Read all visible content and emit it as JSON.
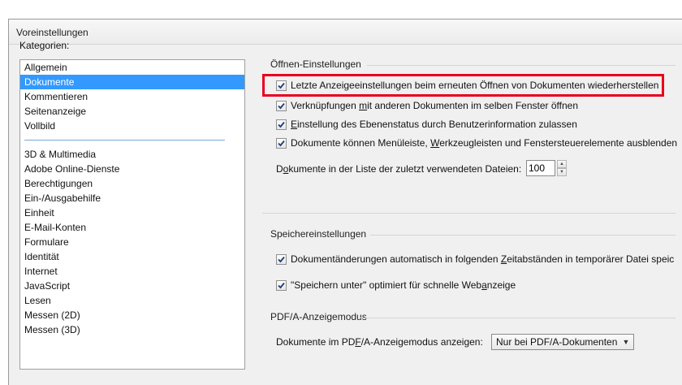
{
  "window": {
    "title": "Voreinstellungen"
  },
  "categories": {
    "label": "Kategorien:",
    "group1": [
      "Allgemein",
      "Dokumente",
      "Kommentieren",
      "Seitenanzeige",
      "Vollbild"
    ],
    "selected": "Dokumente",
    "group2": [
      "3D & Multimedia",
      "Adobe Online-Dienste",
      "Berechtigungen",
      "Ein-/Ausgabehilfe",
      "Einheit",
      "E-Mail-Konten",
      "Formulare",
      "Identität",
      "Internet",
      "JavaScript",
      "Lesen",
      "Messen (2D)",
      "Messen (3D)"
    ]
  },
  "open_settings": {
    "title": "Öffnen-Einstellungen",
    "cb1": {
      "label": "Letzte Anzeigeeinstellungen beim erneuten Öffnen von Dokumenten wiederherstellen",
      "checked": true
    },
    "cb2": {
      "pre": "Verknüpfungen ",
      "ul": "m",
      "post": "it anderen Dokumenten im selben Fenster öffnen",
      "checked": true
    },
    "cb3": {
      "ul": "E",
      "post": "instellung des Ebenenstatus durch Benutzerinformation zulassen",
      "checked": true
    },
    "cb4": {
      "pre": "Dokumente können Menüleiste, ",
      "ul": "W",
      "post": "erkzeugleisten und Fenstersteuerelemente ausblenden",
      "checked": true
    },
    "recent": {
      "pre": "D",
      "ul": "o",
      "post": "kumente in der Liste der zuletzt verwendeten Dateien:",
      "value": "100"
    }
  },
  "save_settings": {
    "title": "Speichereinstellungen",
    "cb1": {
      "pre": "Dokumentänderungen automatisch in folgenden ",
      "ul": "Z",
      "post": "eitabständen in temporärer Datei speic",
      "checked": true
    },
    "cb2": {
      "pre": "\"Speichern unter\" optimiert für schnelle Web",
      "ul": "a",
      "post": "nzeige",
      "checked": true
    }
  },
  "pdfa": {
    "title": "PDF/A-Anzeigemodus",
    "label_pre": "Dokumente im PD",
    "label_ul": "F",
    "label_post": "/A-Anzeigemodus anzeigen:",
    "select_value": "Nur bei PDF/A-Dokumenten"
  },
  "colors": {
    "highlight": "#e8001c",
    "selection": "#3399ff"
  }
}
